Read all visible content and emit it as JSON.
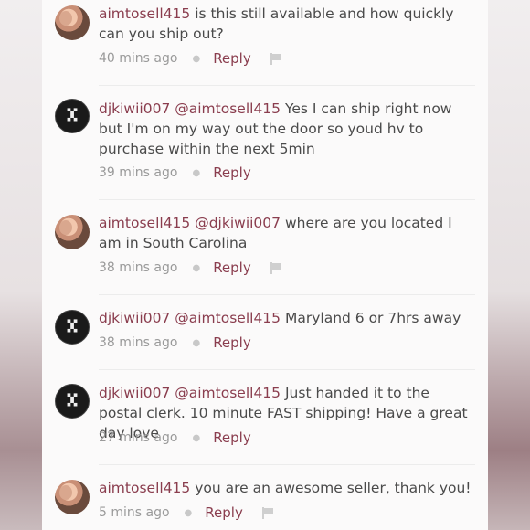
{
  "comments": [
    {
      "user": "aimtosell415",
      "mention": "",
      "text": "is this still available and how quickly can you ship out?",
      "time": "40 mins ago",
      "reply": "Reply",
      "flag": true,
      "avatar": "seller"
    },
    {
      "user": "djkiwii007",
      "mention": "@aimtosell415",
      "text": "Yes I can ship right now but I'm on my way out the door so youd hv to purchase within the next 5min",
      "time": "39 mins ago",
      "reply": "Reply",
      "flag": false,
      "avatar": "buyer"
    },
    {
      "user": "aimtosell415",
      "mention": "@djkiwii007",
      "text": "where are you located I am in South Carolina",
      "time": "38 mins ago",
      "reply": "Reply",
      "flag": true,
      "avatar": "seller"
    },
    {
      "user": "djkiwii007",
      "mention": "@aimtosell415",
      "text": "Maryland 6 or 7hrs away",
      "time": "38 mins ago",
      "reply": "Reply",
      "flag": false,
      "avatar": "buyer"
    },
    {
      "user": "djkiwii007",
      "mention": "@aimtosell415",
      "text": "Just handed it to the postal clerk. 10 minute FAST shipping! Have a great day love",
      "time": "27 mins ago",
      "reply": "Reply",
      "flag": false,
      "avatar": "buyer"
    },
    {
      "user": "aimtosell415",
      "mention": "",
      "text": "you are an awesome seller, thank you!",
      "time": "5 mins ago",
      "reply": "Reply",
      "flag": true,
      "avatar": "seller"
    }
  ],
  "colors": {
    "username": "#8a3d4e",
    "body_text": "#4a4a4a",
    "meta_text": "#9a9a9a"
  },
  "icons": {
    "flag": "flag-icon",
    "separator": "dot-separator"
  }
}
